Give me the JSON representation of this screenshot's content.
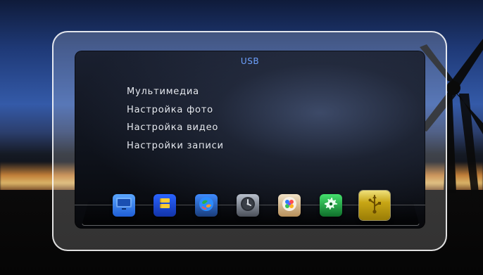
{
  "screen": {
    "title": "USB",
    "menu": [
      {
        "label": "Мультимедиа"
      },
      {
        "label": "Настройка фото"
      },
      {
        "label": "Настройка видео"
      },
      {
        "label": "Настройки записи"
      }
    ]
  },
  "dock": {
    "items": [
      {
        "icon": "monitor-icon"
      },
      {
        "icon": "channel-list-icon"
      },
      {
        "icon": "globe-icon"
      },
      {
        "icon": "clock-icon"
      },
      {
        "icon": "media-icon"
      },
      {
        "icon": "settings-gear-icon"
      },
      {
        "icon": "usb-icon",
        "selected": true
      }
    ]
  },
  "colors": {
    "title": "#6ea2ff",
    "text": "#e9edf5",
    "active_tile": "#c8a615"
  }
}
